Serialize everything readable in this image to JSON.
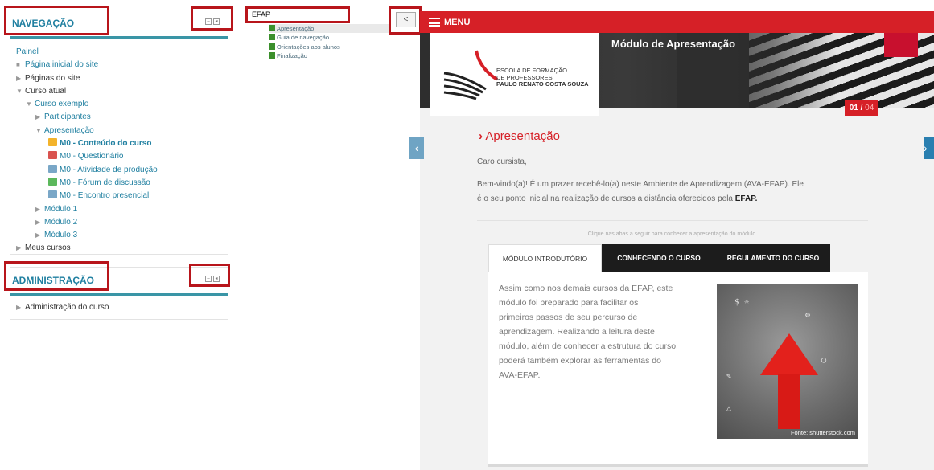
{
  "navigation": {
    "title": "NAVEGAÇÃO",
    "panel": "Painel",
    "home": "Página inicial do site",
    "site_pages": "Páginas do site",
    "current_course": "Curso atual",
    "course": "Curso exemplo",
    "participants": "Participantes",
    "presentation": "Apresentação",
    "activities": [
      {
        "label": "M0 - Conteúdo do curso",
        "icon": "content-icon"
      },
      {
        "label": "M0 - Questionário",
        "icon": "quiz-icon"
      },
      {
        "label": "M0 - Atividade de produção",
        "icon": "assignment-icon"
      },
      {
        "label": "M0 - Fórum de discussão",
        "icon": "forum-icon"
      },
      {
        "label": "M0 - Encontro presencial",
        "icon": "assignment-icon"
      }
    ],
    "modules": [
      "Módulo 1",
      "Módulo 2",
      "Módulo 3"
    ],
    "my_courses": "Meus cursos"
  },
  "administration": {
    "title": "ADMINISTRAÇÃO",
    "item": "Administração do curso"
  },
  "efap_tree": {
    "title": "EFAP",
    "items": [
      "Apresentação",
      "Guia de navegação",
      "Orientações aos alunos",
      "Finalização"
    ]
  },
  "collapse_label": "<",
  "course": {
    "menu_label": "MENU",
    "logo_line1": "ESCOLA DE FORMAÇÃO",
    "logo_line2": "DE PROFESSORES",
    "logo_line3": "PAULO RENATO COSTA SOUZA",
    "banner_title": "Módulo de Apresentação",
    "page_current": "01",
    "page_total": "04",
    "section_title": "Apresentação",
    "greeting": "Caro cursista,",
    "intro_part1": "Bem-vindo(a)! É um prazer recebê-lo(a) neste Ambiente de Aprendizagem (AVA-EFAP). Ele",
    "intro_part2": "é o seu ponto inicial na realização de cursos a distância oferecidos pela ",
    "intro_link": "EFAP.",
    "hint": "Clique nas abas a seguir para conhecer a apresentação do módulo.",
    "tabs": [
      "MÓDULO INTRODUTÓRIO",
      "CONHECENDO O CURSO",
      "REGULAMENTO DO CURSO"
    ],
    "tab_text_lines": [
      "Assim como nos demais cursos da EFAP, este",
      "módulo foi preparado para facilitar os",
      "primeiros passos de seu percurso de",
      "aprendizagem. Realizando a leitura deste",
      "módulo, além de conhecer a estrutura do curso,",
      "poderá também explorar as ferramentas do",
      "AVA-EFAP."
    ],
    "photo_credit": "Fonte: shutterstock.com"
  },
  "colors": {
    "accent_red": "#d62027",
    "link_blue": "#1f7fa0",
    "annotation_red": "#b8151b"
  }
}
